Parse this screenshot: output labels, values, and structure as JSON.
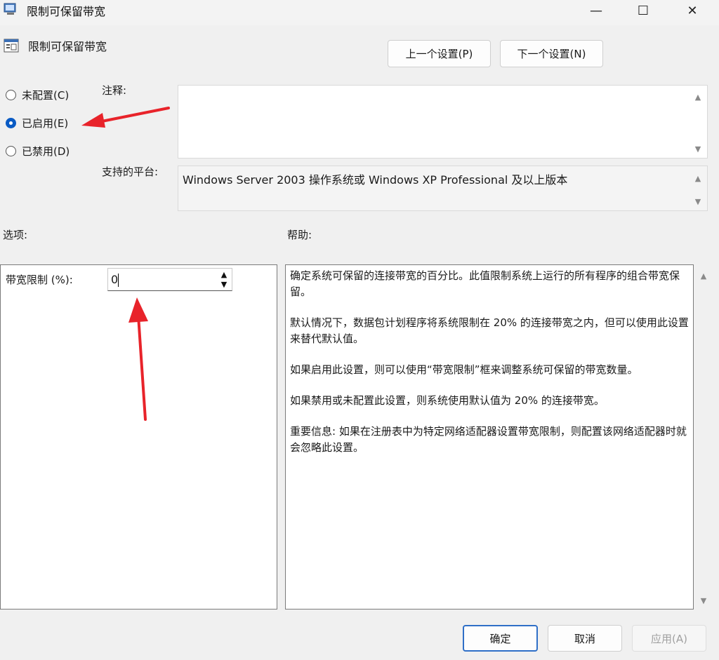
{
  "window": {
    "title": "限制可保留带宽",
    "minimize": "—",
    "maximize": "☐",
    "close": "✕"
  },
  "header": {
    "title": "限制可保留带宽",
    "prev_button": "上一个设置(P)",
    "next_button": "下一个设置(N)"
  },
  "state": {
    "options": [
      {
        "label": "未配置(C)",
        "checked": false
      },
      {
        "label": "已启用(E)",
        "checked": true
      },
      {
        "label": "已禁用(D)",
        "checked": false
      }
    ]
  },
  "comment": {
    "label": "注释:",
    "value": ""
  },
  "platform": {
    "label": "支持的平台:",
    "value": "Windows Server 2003 操作系统或 Windows XP Professional 及以上版本"
  },
  "options_section": {
    "label": "选项:",
    "bandwidth_label": "带宽限制 (%):",
    "bandwidth_value": "0"
  },
  "help_section": {
    "label": "帮助:",
    "paragraphs": [
      "确定系统可保留的连接带宽的百分比。此值限制系统上运行的所有程序的组合带宽保留。",
      "默认情况下，数据包计划程序将系统限制在 20% 的连接带宽之内，但可以使用此设置来替代默认值。",
      "如果启用此设置，则可以使用“带宽限制”框来调整系统可保留的带宽数量。",
      "如果禁用或未配置此设置，则系统使用默认值为 20% 的连接带宽。",
      "重要信息: 如果在注册表中为特定网络适配器设置带宽限制，则配置该网络适配器时就会忽略此设置。"
    ]
  },
  "footer": {
    "ok": "确定",
    "cancel": "取消",
    "apply": "应用(A)"
  },
  "colors": {
    "accent": "#0a5bc4",
    "annotation_arrow": "#e8232a"
  }
}
